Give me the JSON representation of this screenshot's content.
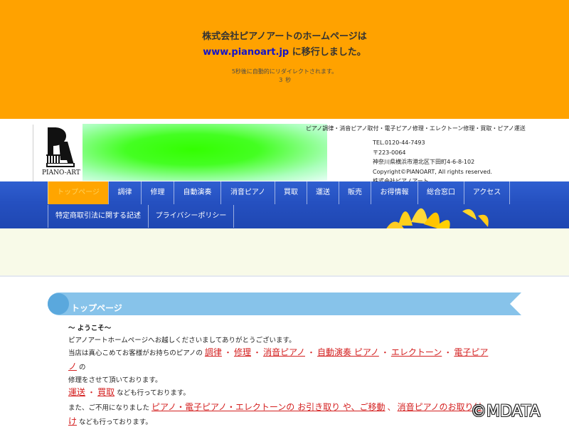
{
  "redirect": {
    "line1": "株式会社ピアノアートのホームページは",
    "link": "www.pianoart.jp",
    "line2_suffix": " に移行しました。",
    "note": "5秒後に自動的にリダイレクトされます。",
    "countdown": "３ 秒"
  },
  "header": {
    "logo_text": "PIANO-ART",
    "tagline": "ピアノ調律・消音ピアノ取付・電子ピアノ修理・エレクトーン修理・買取・ピアノ運送",
    "tel": "TEL.0120-44-7493",
    "postal": "〒223-0064",
    "address": "神奈川県横浜市港北区下田町4-6-8-102",
    "copyright": "Copyright©PIANOART, All rights reserved.",
    "company": "株式会社ピアノアート"
  },
  "nav": {
    "row1": [
      "トップページ",
      "調律",
      "修理",
      "自動演奏",
      "消音ピアノ",
      "買取",
      "運送",
      "販売",
      "お得情報",
      "総合窓口",
      "アクセス"
    ],
    "row2": [
      "特定商取引法に関する記述",
      "プライバシーポリシー"
    ],
    "active_index": 0
  },
  "main": {
    "title": "トップページ",
    "welcome": "～ ようこそ～",
    "line1": "ピアノアートホームページへお越しくださいましてありがとうございます。",
    "line2_prefix": "当店は真心こめてお客様がお持ちのピアノの",
    "links_a": [
      "調律",
      "修理",
      "消音ピアノ",
      "自動演奏 ピアノ",
      "エレクトーン",
      "電子ピア"
    ],
    "link_a_wrap": "ノ",
    "line2_suffix": "の",
    "line3": "修理をさせて頂いております。",
    "links_b": [
      "運送",
      "買取"
    ],
    "line4_suffix": "なども行っております。",
    "line5_prefix": "また、ご不用になりました",
    "link_c": "ピアノ・電子ピアノ・エレクトーンの お引き取り や、ご移動",
    "link_d": "消音ピアノのお取り付",
    "link_d_wrap": "け",
    "line6_suffix": "なども行っております。"
  },
  "watermark": "©MDATA",
  "colors": {
    "banner": "#ffa200",
    "nav": "#2550c0",
    "nav_active": "#ffa500",
    "link_red": "#d42020",
    "title_bar": "#87c3ea"
  }
}
